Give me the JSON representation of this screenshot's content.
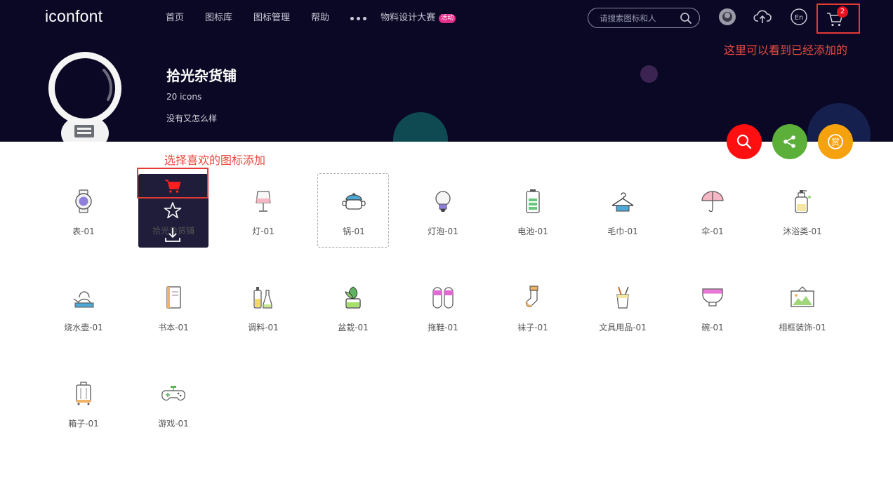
{
  "header": {
    "logo": "iconfont",
    "nav": [
      "首页",
      "图标库",
      "图标管理",
      "帮助"
    ],
    "nav_more": "more-dots-icon",
    "contest_label": "物料设计大赛",
    "contest_badge": "活动",
    "search_placeholder": "请搜索图标和人",
    "cart_count": "2"
  },
  "annotations": {
    "cart_note": "这里可以看到已经添加的",
    "add_note": "选择喜欢的图标添加"
  },
  "shop": {
    "title": "拾光杂货铺",
    "count": "20 icons",
    "desc": "没有又怎么样"
  },
  "colors": {
    "banner": "#0a0824",
    "fab_search": "#ff0f0f",
    "fab_share": "#5cb03a",
    "fab_reward": "#f5a20e",
    "annotation": "#e53935"
  },
  "icons": [
    {
      "label": "表-01",
      "icon": "watch-icon"
    },
    {
      "label": "拾光杂货铺",
      "icon": "hover-actions"
    },
    {
      "label": "灯-01",
      "icon": "lamp-icon"
    },
    {
      "label": "锅-01",
      "icon": "pot-icon"
    },
    {
      "label": "灯泡-01",
      "icon": "bulb-icon"
    },
    {
      "label": "电池-01",
      "icon": "battery-icon"
    },
    {
      "label": "毛巾-01",
      "icon": "towel-icon"
    },
    {
      "label": "伞-01",
      "icon": "umbrella-icon"
    },
    {
      "label": "沐浴类-01",
      "icon": "bath-bottle-icon"
    },
    {
      "label": "烧水壶-01",
      "icon": "kettle-icon"
    },
    {
      "label": "书本-01",
      "icon": "book-icon"
    },
    {
      "label": "调料-01",
      "icon": "seasoning-icon"
    },
    {
      "label": "盆栽-01",
      "icon": "plant-icon"
    },
    {
      "label": "拖鞋-01",
      "icon": "slippers-icon"
    },
    {
      "label": "袜子-01",
      "icon": "sock-icon"
    },
    {
      "label": "文具用品-01",
      "icon": "stationery-icon"
    },
    {
      "label": "碗-01",
      "icon": "bowl-icon"
    },
    {
      "label": "相框装饰-01",
      "icon": "frame-icon"
    },
    {
      "label": "箱子-01",
      "icon": "suitcase-icon"
    },
    {
      "label": "游戏-01",
      "icon": "gamepad-icon"
    }
  ]
}
